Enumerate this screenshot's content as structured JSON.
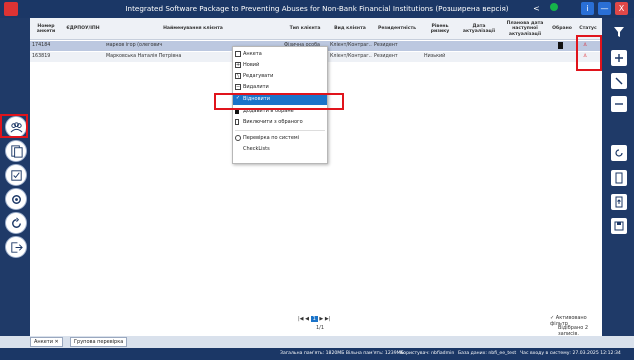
{
  "app": {
    "title": "Integrated Software Package to Preventing Abuses for Non-Bank Financial Institutions (Розширена версія)"
  },
  "titlebar": {
    "info_label": "i",
    "minimize_label": "—",
    "close_label": "X"
  },
  "table": {
    "headers": [
      "Номер анкети",
      "ЄДРПОУ/ІПН",
      "Найменування клієнта",
      "Тип клієнта",
      "Вид клієнта",
      "Резидентність",
      "Рівень ризику",
      "Дата актуалізації",
      "Планова дата наступної актуалізації",
      "Обрано",
      "Статус"
    ],
    "rows": [
      [
        "174184",
        "",
        "марков ігор (олегович",
        "Фізична особа",
        "Клієнт/Контраг...",
        "Резидент",
        "",
        "",
        "",
        "bookmark",
        "status"
      ],
      [
        "163819",
        "",
        "Марковська Наталія Петрівна",
        "Фізична особа",
        "Клієнт/Контраг...",
        "Резидент",
        "Низький",
        "",
        "",
        "",
        "status"
      ]
    ]
  },
  "context_menu": {
    "items": [
      "Анкета",
      "Новий",
      "Редагувати",
      "Видалити",
      "Відновити",
      "Додавити в обране",
      "Виключити з обраного",
      "Перевірка по системі CheckLists"
    ]
  },
  "pager": {
    "current": "1",
    "summary": "1/1"
  },
  "filter": {
    "label": "Активовано фільтр",
    "selected_text": "Відібрано 2 записів."
  },
  "tabs": [
    "Анкети",
    "Групова перевірка"
  ],
  "status": {
    "memory": "Загальна пам'ять: 1820МБ Вільна пам'ять: 1239МБ",
    "user": "Користувач: nbfiadmin",
    "db": "База даних: nbfi_ee_test",
    "login": "Час входу в систему: 27.03.2025 12:12:34"
  },
  "colors": {
    "accent": "#1b3766",
    "highlight": "#1a73c9",
    "annotation": "#e0141c"
  }
}
